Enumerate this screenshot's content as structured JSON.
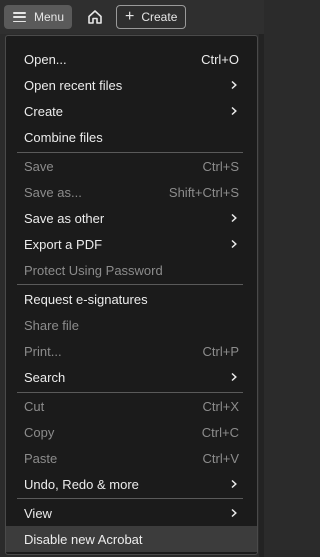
{
  "toolbar": {
    "menu_label": "Menu",
    "create_label": "Create"
  },
  "menu": {
    "items": [
      {
        "label": "Open...",
        "shortcut": "Ctrl+O",
        "submenu": false,
        "enabled": true
      },
      {
        "label": "Open recent files",
        "shortcut": "",
        "submenu": true,
        "enabled": true
      },
      {
        "label": "Create",
        "shortcut": "",
        "submenu": true,
        "enabled": true
      },
      {
        "label": "Combine files",
        "shortcut": "",
        "submenu": false,
        "enabled": true
      },
      {
        "label": "Save",
        "shortcut": "Ctrl+S",
        "submenu": false,
        "enabled": false
      },
      {
        "label": "Save as...",
        "shortcut": "Shift+Ctrl+S",
        "submenu": false,
        "enabled": false
      },
      {
        "label": "Save as other",
        "shortcut": "",
        "submenu": true,
        "enabled": true
      },
      {
        "label": "Export a PDF",
        "shortcut": "",
        "submenu": true,
        "enabled": true
      },
      {
        "label": "Protect Using Password",
        "shortcut": "",
        "submenu": false,
        "enabled": false
      },
      {
        "label": "Request e-signatures",
        "shortcut": "",
        "submenu": false,
        "enabled": true
      },
      {
        "label": "Share file",
        "shortcut": "",
        "submenu": false,
        "enabled": false
      },
      {
        "label": "Print...",
        "shortcut": "Ctrl+P",
        "submenu": false,
        "enabled": false
      },
      {
        "label": "Search",
        "shortcut": "",
        "submenu": true,
        "enabled": true
      },
      {
        "label": "Cut",
        "shortcut": "Ctrl+X",
        "submenu": false,
        "enabled": false
      },
      {
        "label": "Copy",
        "shortcut": "Ctrl+C",
        "submenu": false,
        "enabled": false
      },
      {
        "label": "Paste",
        "shortcut": "Ctrl+V",
        "submenu": false,
        "enabled": false
      },
      {
        "label": "Undo, Redo & more",
        "shortcut": "",
        "submenu": true,
        "enabled": true
      },
      {
        "label": "View",
        "shortcut": "",
        "submenu": true,
        "enabled": true
      },
      {
        "label": "Disable new Acrobat",
        "shortcut": "",
        "submenu": false,
        "enabled": true
      }
    ]
  },
  "colors": {
    "panel_bg": "#1b1b1b",
    "text": "#ececec",
    "disabled_text": "#8c8c8c",
    "highlight_bg": "#3c3c3c",
    "separator": "#5a5a5a"
  }
}
